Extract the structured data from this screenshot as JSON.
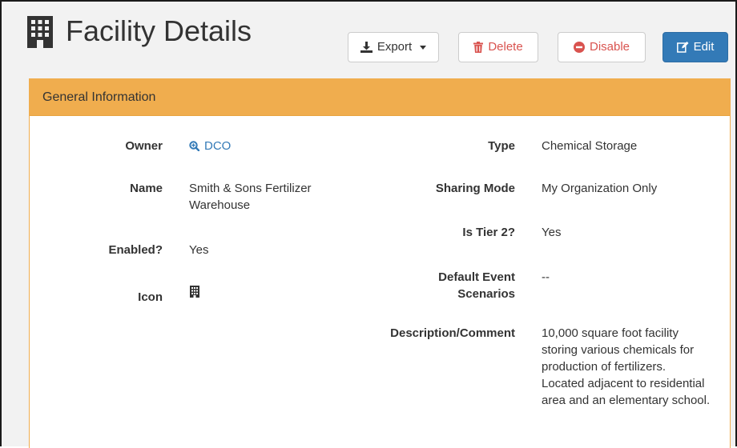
{
  "header": {
    "title": "Facility Details",
    "title_icon": "building-icon",
    "buttons": {
      "export": "Export",
      "delete": "Delete",
      "disable": "Disable",
      "edit": "Edit"
    }
  },
  "panel": {
    "heading": "General Information",
    "left_fields": {
      "owner_label": "Owner",
      "owner_value": "DCO",
      "name_label": "Name",
      "name_value_1": "Smith & Sons Fertilizer",
      "name_value_2": "Warehouse",
      "enabled_label": "Enabled?",
      "enabled_value": "Yes",
      "icon_label": "Icon"
    },
    "right_fields": {
      "type_label": "Type",
      "type_value": "Chemical Storage",
      "sharing_label": "Sharing Mode",
      "sharing_value": "My Organization Only",
      "tier2_label": "Is Tier 2?",
      "tier2_value": "Yes",
      "default_label_1": "Default Event",
      "default_label_2": "Scenarios",
      "default_value": "--",
      "desc_label": "Description/Comment",
      "desc_lines": [
        "10,000 square foot facility",
        "storing various chemicals for",
        "production of fertilizers.",
        "Located adjacent to residential",
        "area and an elementary school."
      ]
    }
  },
  "colors": {
    "panel_heading": "#f0ad4e",
    "primary": "#337ab7",
    "danger": "#d9534f"
  }
}
